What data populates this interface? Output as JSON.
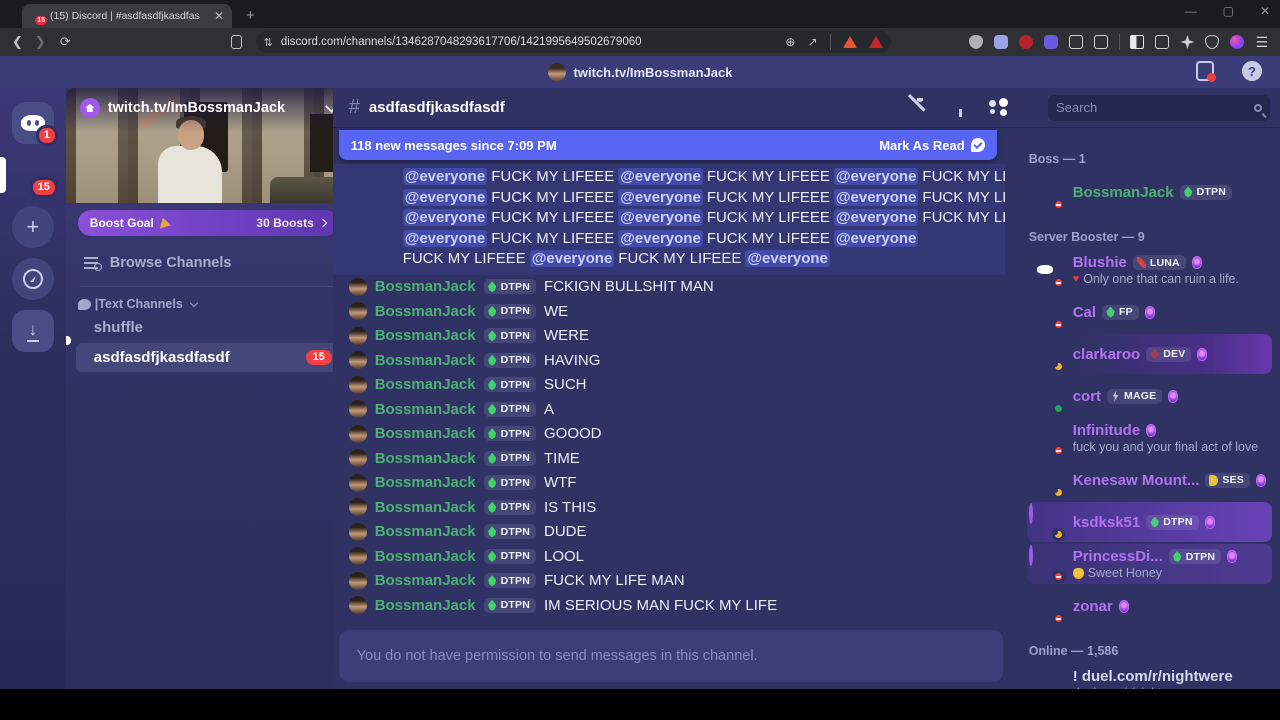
{
  "browser": {
    "tab_title": "(15) Discord | #asdfasdfjkasdfas",
    "tab_favicon_badge": "15",
    "url": "discord.com/channels/1346287048293617706/1421995649502679060",
    "extensions": [
      "shield-gray",
      "square-lavender",
      "circle-red",
      "square-purple",
      "puzzle",
      "box-a"
    ],
    "actions": [
      "sidebar-panel",
      "wallet",
      "sparkle",
      "shield-check",
      "profile"
    ]
  },
  "titlebar": {
    "server_title": "twitch.tv/ImBossmanJack"
  },
  "rail": {
    "home_badge": "1",
    "server_badge": "15"
  },
  "sidebar": {
    "server_name": "twitch.tv/ImBossmanJack",
    "boost_label": "Boost Goal",
    "boost_value": "30 Boosts",
    "browse_label": "Browse Channels",
    "category_label": "|Text Channels",
    "channels": [
      {
        "name": "shuffle",
        "type": "rules",
        "selected": false
      },
      {
        "name": "asdfasdfjkasdfasdf",
        "type": "text",
        "selected": true,
        "badge": "15"
      }
    ]
  },
  "chat": {
    "channel_name": "asdfasdfjkasdfasdf",
    "search_placeholder": "Search",
    "new_messages_text": "118 new messages since 7:09 PM",
    "mark_as_read": "Mark As Read",
    "author": "BossmanJack",
    "author_badge": "DTPN",
    "mention_lines": [
      {
        "segs": [
          {
            "kind": "mention",
            "text": "@everyone"
          },
          {
            "kind": "text",
            "text": "FUCK MY LIFEEE"
          },
          {
            "kind": "mention",
            "text": "@everyone"
          },
          {
            "kind": "text",
            "text": "FUCK MY LIFEEE"
          },
          {
            "kind": "mention",
            "text": "@everyone"
          },
          {
            "kind": "text",
            "text": "FUCK MY LIFEEE"
          }
        ]
      },
      {
        "segs": [
          {
            "kind": "mention",
            "text": "@everyone"
          },
          {
            "kind": "text",
            "text": "FUCK MY LIFEEE"
          },
          {
            "kind": "mention",
            "text": "@everyone"
          },
          {
            "kind": "text",
            "text": "FUCK MY LIFEEE"
          },
          {
            "kind": "mention",
            "text": "@everyone"
          },
          {
            "kind": "text",
            "text": "FUCK MY LIFEEE"
          }
        ]
      },
      {
        "segs": [
          {
            "kind": "mention",
            "text": "@everyone"
          },
          {
            "kind": "text",
            "text": "FUCK MY LIFEEE"
          },
          {
            "kind": "mention",
            "text": "@everyone"
          },
          {
            "kind": "text",
            "text": "FUCK MY LIFEEE"
          },
          {
            "kind": "mention",
            "text": "@everyone"
          },
          {
            "kind": "text",
            "text": "FUCK MY LIFEEE"
          }
        ]
      },
      {
        "segs": [
          {
            "kind": "mention",
            "text": "@everyone"
          },
          {
            "kind": "text",
            "text": "FUCK MY LIFEEE"
          },
          {
            "kind": "mention",
            "text": "@everyone"
          },
          {
            "kind": "text",
            "text": "FUCK MY LIFEEE"
          },
          {
            "kind": "mention",
            "text": "@everyone"
          }
        ]
      },
      {
        "segs": [
          {
            "kind": "text",
            "text": "FUCK MY LIFEEE"
          },
          {
            "kind": "mention",
            "text": "@everyone"
          },
          {
            "kind": "text",
            "text": "FUCK MY LIFEEE"
          },
          {
            "kind": "mention",
            "text": "@everyone"
          }
        ]
      }
    ],
    "messages": [
      "FCKIGN BULLSHIT MAN",
      "WE",
      "WERE",
      "HAVING",
      "SUCH",
      "A",
      "GOOOD",
      "TIME",
      "WTF",
      "IS THIS",
      "DUDE",
      "LOOL",
      "FUCK MY LIFE MAN",
      "IM SERIOUS MAN FUCK MY LIFE"
    ],
    "composer_notice": "You do not have permission to send messages in this channel."
  },
  "members": {
    "sections": [
      {
        "header": "Boss — 1",
        "members": [
          {
            "name": "BossmanJack",
            "color": "boss",
            "avatar": "bossman",
            "status": "dnd",
            "badge": {
              "icon": "flame",
              "label": "DTPN"
            }
          }
        ]
      },
      {
        "header": "Server Booster — 9",
        "members": [
          {
            "name": "Blushie",
            "color": "booster",
            "avatar": "blushie",
            "status": "dnd",
            "gem": true,
            "badge": {
              "icon": "swords",
              "label": "LUNA"
            },
            "custom": {
              "icon": "kiss",
              "text": "Only one that can ruin a life."
            }
          },
          {
            "name": "Cal",
            "color": "booster",
            "avatar": "cal",
            "status": "dnd",
            "gem": true,
            "badge": {
              "icon": "flame",
              "label": "FP"
            }
          },
          {
            "name": "clarkaroo",
            "color": "booster",
            "avatar": "clarkaroo",
            "status": "idle",
            "gem": true,
            "badge": {
              "icon": "diamond",
              "label": "DEV"
            },
            "nameplate": "flames"
          },
          {
            "name": "cort",
            "color": "booster",
            "avatar": "cort",
            "status": "online",
            "gem": true,
            "badge": {
              "icon": "bolt",
              "label": "MAGE"
            }
          },
          {
            "name": "Infinitude",
            "color": "booster",
            "avatar": "infinitude",
            "status": "dnd",
            "gem": true,
            "custom": {
              "text": "fuck you and your final act of love"
            }
          },
          {
            "name": "Kenesaw Mount...",
            "color": "booster",
            "avatar": "kenesaw",
            "status": "idle",
            "gem": true,
            "badge": {
              "icon": "mug",
              "label": "SES"
            }
          },
          {
            "name": "ksdksk51",
            "color": "booster",
            "avatar": "ksdksk",
            "status": "idle",
            "gem": true,
            "badge": {
              "icon": "flame",
              "label": "DTPN"
            },
            "nameplate": "purple"
          },
          {
            "name": "PrincessDi...",
            "color": "booster",
            "avatar": "princess",
            "status": "dnd",
            "gem": true,
            "badge": {
              "icon": "flame",
              "label": "DTPN"
            },
            "nameplate": "purple-soft",
            "custom": {
              "icon": "honey",
              "text": "Sweet Honey"
            }
          },
          {
            "name": "zonar",
            "color": "booster",
            "avatar": "zonar",
            "status": "dnd",
            "gem": true
          }
        ]
      },
      {
        "header": "Online — 1,586",
        "members": [
          {
            "name": "! duel.com/r/nightwere",
            "color": "default",
            "avatar": "duel",
            "status": "dnd",
            "custom": {
              "text": "duel.com/r/nightwere"
            }
          }
        ]
      }
    ]
  }
}
